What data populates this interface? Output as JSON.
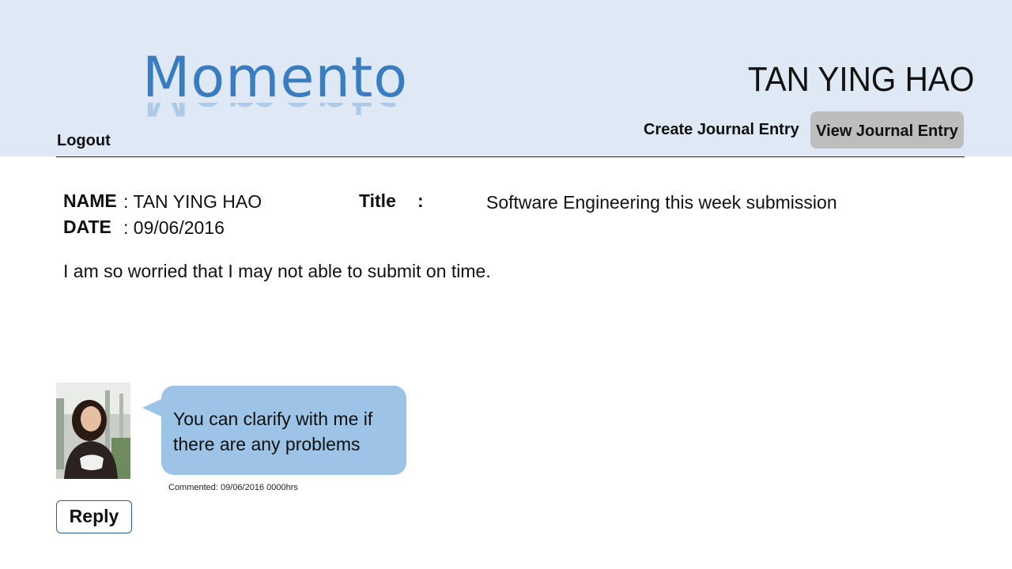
{
  "app": {
    "logo_text": "Momento",
    "user_name": "TAN YING HAO"
  },
  "nav": {
    "logout": "Logout",
    "create_entry": "Create Journal Entry",
    "view_entry": "View Journal Entry"
  },
  "entry": {
    "name_label": "NAME",
    "name_value": ": TAN YING HAO",
    "date_label": "DATE",
    "date_value": ": 09/06/2016",
    "title_label": "Title",
    "title_colon": ":",
    "title_value": "Software Engineering this week submission",
    "body": "I am so worried that I may not able to submit on time."
  },
  "comment": {
    "text": "You can clarify with me if there are any problems",
    "meta": "Commented:  09/06/2016  0000hrs"
  },
  "actions": {
    "reply": "Reply"
  },
  "colors": {
    "header_bg": "#dee9f5",
    "logo": "#3a7cc0",
    "bubble": "#9dc3e6",
    "active_tab": "#bdbdbd"
  }
}
